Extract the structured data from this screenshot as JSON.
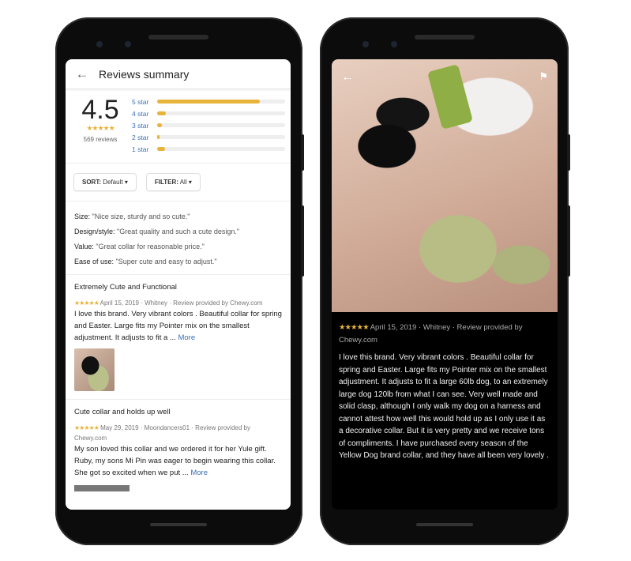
{
  "left": {
    "header": {
      "back_icon": "arrow-left",
      "title": "Reviews summary"
    },
    "summary": {
      "rating": "4.5",
      "stars": "★★★★★",
      "count": "569 reviews",
      "bars": [
        {
          "label": "5 star",
          "percent": 80
        },
        {
          "label": "4 star",
          "percent": 7
        },
        {
          "label": "3 star",
          "percent": 4
        },
        {
          "label": "2 star",
          "percent": 1
        },
        {
          "label": "1 star",
          "percent": 6
        }
      ]
    },
    "sort": {
      "label": "SORT:",
      "value": "Default"
    },
    "filter": {
      "label": "FILTER:",
      "value": "All"
    },
    "attributes": [
      {
        "k": "Size:",
        "v": "\"Nice size, sturdy and so cute.\""
      },
      {
        "k": "Design/style:",
        "v": "\"Great quality and such a cute design.\""
      },
      {
        "k": "Value:",
        "v": "\"Great collar for reasonable price.\""
      },
      {
        "k": "Ease of use:",
        "v": "\"Super cute and easy to adjust.\""
      }
    ],
    "reviews": [
      {
        "title": "Extremely Cute and Functional",
        "stars": "★★★★★",
        "meta": "April 15, 2019 · Whitney · Review provided by Chewy.com",
        "body": "I love this brand. Very vibrant colors . Beautiful collar for spring and Easter. Large fits my Pointer mix on the smallest adjustment. It adjusts to fit a ...",
        "more": "More"
      },
      {
        "title": "Cute collar and holds up well",
        "stars": "★★★★★",
        "meta": "May 29, 2019 · Moondancers01 · Review provided by Chewy.com",
        "body": "My son loved this collar and we ordered it for her Yule gift. Ruby, my sons Mi Pin was eager to begin wearing this collar. She got so excited when we put ...",
        "more": "More"
      }
    ]
  },
  "right": {
    "back_icon": "arrow-left",
    "flag_icon": "flag",
    "stars": "★★★★★",
    "meta": "April 15, 2019 · Whitney · Review provided by Chewy.com",
    "body": "I love this brand. Very vibrant colors . Beautiful collar for spring and Easter. Large fits my Pointer mix on the smallest adjustment. It adjusts to fit a large 60lb dog, to an extremely large dog 120lb from what I can see. Very well made and solid clasp, although I only walk my dog on a harness and cannot attest how well this would hold up as I only use it as a decorative collar. But it is very pretty and we receive tons of compliments. I have purchased every season of the Yellow Dog brand collar, and they have all been very lovely ."
  },
  "colors": {
    "star": "#e8b33a",
    "link": "#3b6fb6"
  }
}
